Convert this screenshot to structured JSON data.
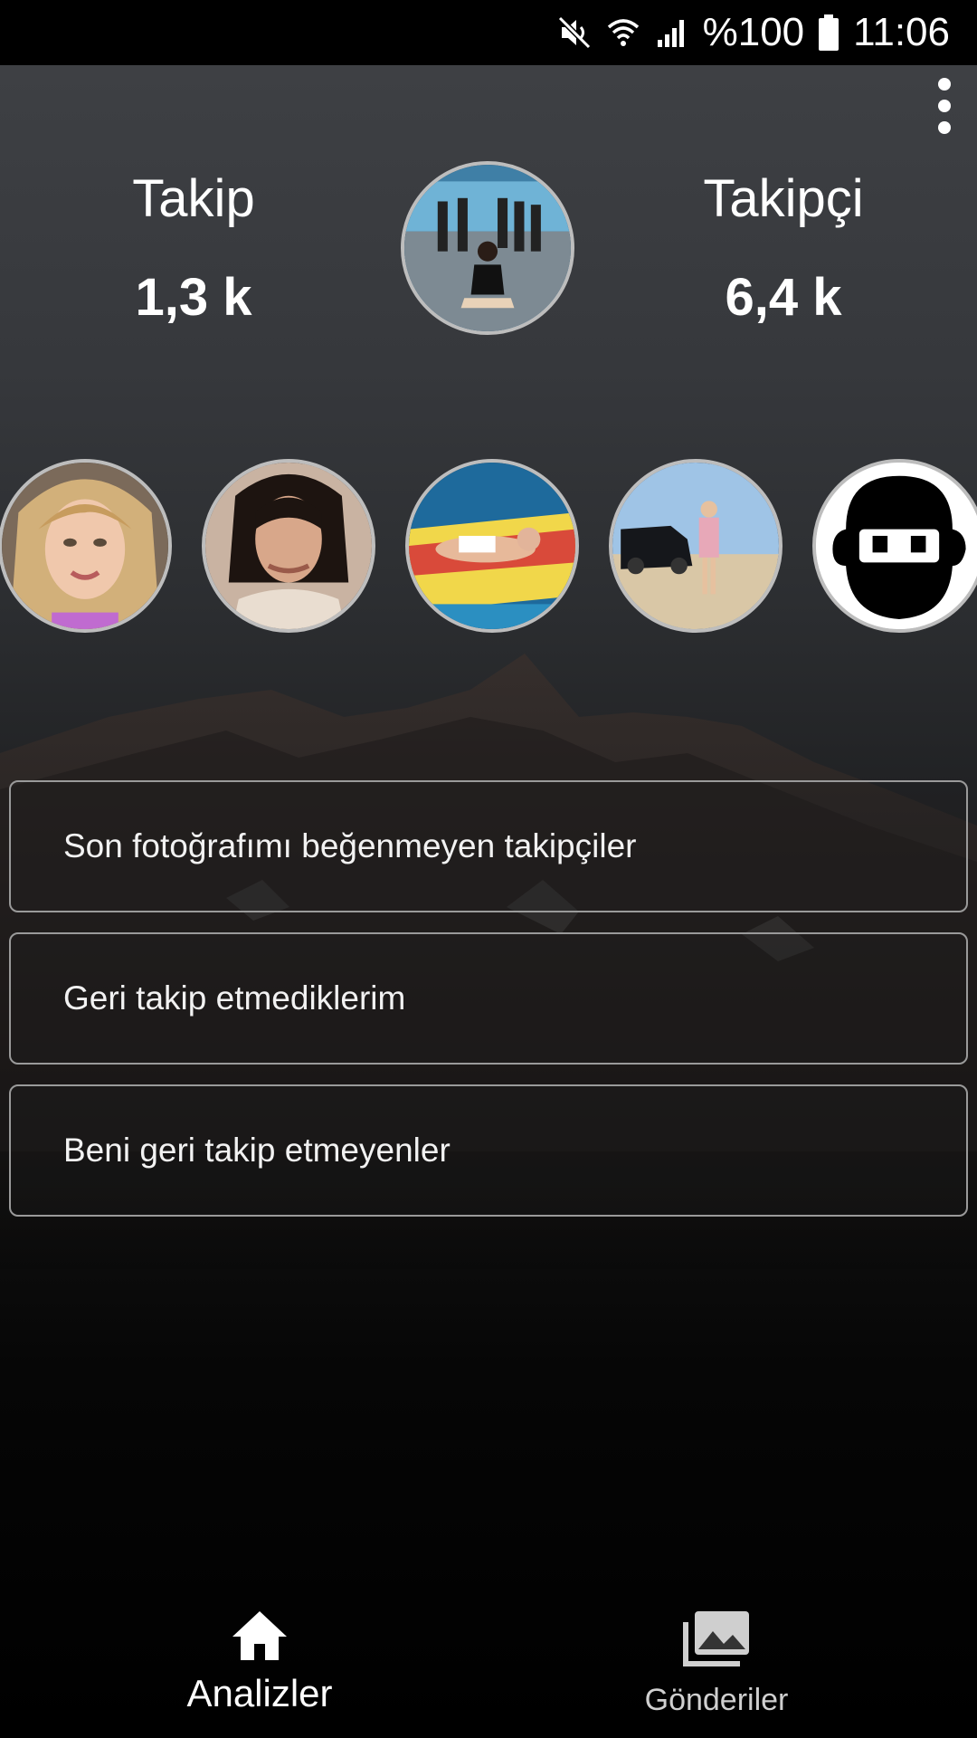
{
  "status_bar": {
    "battery_text": "%100",
    "time": "11:06",
    "icons": [
      "mute-icon",
      "wifi-icon",
      "signal-icon",
      "battery-icon"
    ]
  },
  "header": {
    "menu_icon": "more-vertical-icon"
  },
  "stats": {
    "following_label": "Takip",
    "following_value": "1,3 k",
    "followers_label": "Takipçi",
    "followers_value": "6,4 k"
  },
  "story_strip": {
    "count": 5
  },
  "options": [
    {
      "label": "Son fotoğrafımı beğenmeyen takipçiler"
    },
    {
      "label": "Geri takip etmediklerim"
    },
    {
      "label": "Beni geri takip etmeyenler"
    }
  ],
  "bottom_nav": {
    "items": [
      {
        "label": "Analizler",
        "icon": "home-icon",
        "active": true
      },
      {
        "label": "Gönderiler",
        "icon": "gallery-icon",
        "active": false
      }
    ]
  },
  "colors": {
    "background_top": "#3e4044",
    "background_bottom": "#000000",
    "border": "#9a9a9a",
    "text": "#ffffff"
  }
}
